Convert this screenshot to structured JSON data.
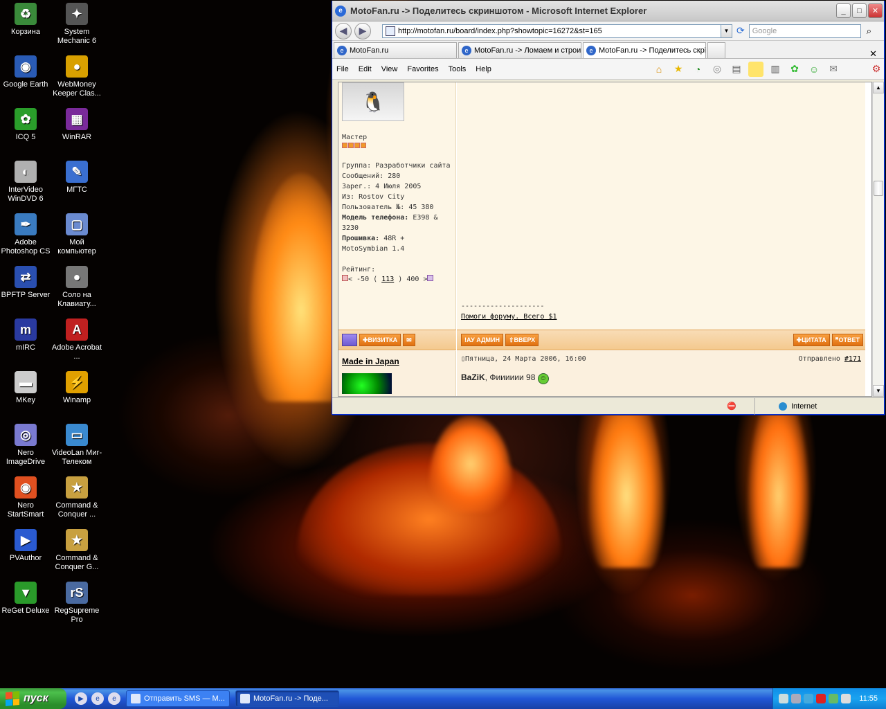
{
  "desktop": {
    "icons": [
      {
        "label": "Корзина"
      },
      {
        "label": "System Mechanic 6"
      },
      {
        "label": "Google Earth"
      },
      {
        "label": "WebMoney Keeper Clas..."
      },
      {
        "label": "ICQ 5"
      },
      {
        "label": "WinRAR"
      },
      {
        "label": "InterVideo WinDVD 6"
      },
      {
        "label": "МГТС"
      },
      {
        "label": "Adobe Photoshop CS"
      },
      {
        "label": "Мой компьютер"
      },
      {
        "label": "BPFTP Server"
      },
      {
        "label": "Соло на Клавиату..."
      },
      {
        "label": "mIRC"
      },
      {
        "label": "Adobe Acrobat ..."
      },
      {
        "label": "MKey"
      },
      {
        "label": "Winamp"
      },
      {
        "label": "Nero ImageDrive"
      },
      {
        "label": "VideoLan Миг-Телеком"
      },
      {
        "label": "Nero StartSmart"
      },
      {
        "label": "Command & Conquer ..."
      },
      {
        "label": "PVAuthor"
      },
      {
        "label": "Command & Conquer G..."
      },
      {
        "label": "ReGet Deluxe"
      },
      {
        "label": "RegSupreme Pro"
      }
    ]
  },
  "browser": {
    "title": "MotoFan.ru -> Поделитесь скриншотом - Microsoft Internet Explorer",
    "url": "http://motofan.ru/board/index.php?showtopic=16272&st=165",
    "search_placeholder": "Google",
    "tabs": [
      {
        "label": "MotoFan.ru"
      },
      {
        "label": "MotoFan.ru -> Ломаем и строи"
      },
      {
        "label": "MotoFan.ru -> Поделитесь скрі"
      }
    ],
    "menu": {
      "file": "File",
      "edit": "Edit",
      "view": "View",
      "favorites": "Favorites",
      "tools": "Tools",
      "help": "Help"
    },
    "status_zone": "Internet"
  },
  "forum": {
    "post1": {
      "rank": "Мастер",
      "group": "Группа: Разработчики сайта",
      "messages": "Сообщений: 280",
      "registered": "Зарег.: 4 Июля 2005",
      "from": "Из: Rostov City",
      "user_no": "Пользователь №: 45 380",
      "phone_label": "Модель телефона:",
      "phone_value": "E398 & 3230",
      "firmware_label": "Прошивка:",
      "firmware_value": "48R + MotoSymbian 1.4",
      "rating_label": "Рейтинг:",
      "rating_low": "< -50 (",
      "rating_value": "113",
      "rating_high": ") 400 >",
      "signature_sep": "--------------------",
      "signature_link": "Помоги форуму. Всего $1",
      "btn_card": "ВИЗИТКА",
      "btn_admin": "АУ АДМИН",
      "btn_up": "ВВЕРХ",
      "btn_quote": "ЦИТАТА",
      "btn_reply": "ОТВЕТ"
    },
    "post2": {
      "author": "Made in Japan",
      "date": "Пятница, 24 Марта 2006, 16:00",
      "sent_label": "Отправлено",
      "post_no": "#171",
      "reply_to": "BaZiK",
      "text": ", Фииииии 98"
    }
  },
  "taskbar": {
    "start": "пуск",
    "tasks": [
      {
        "label": "Отправить SMS — М..."
      },
      {
        "label": "MotoFan.ru -> Поде..."
      }
    ],
    "clock": "11:55"
  }
}
